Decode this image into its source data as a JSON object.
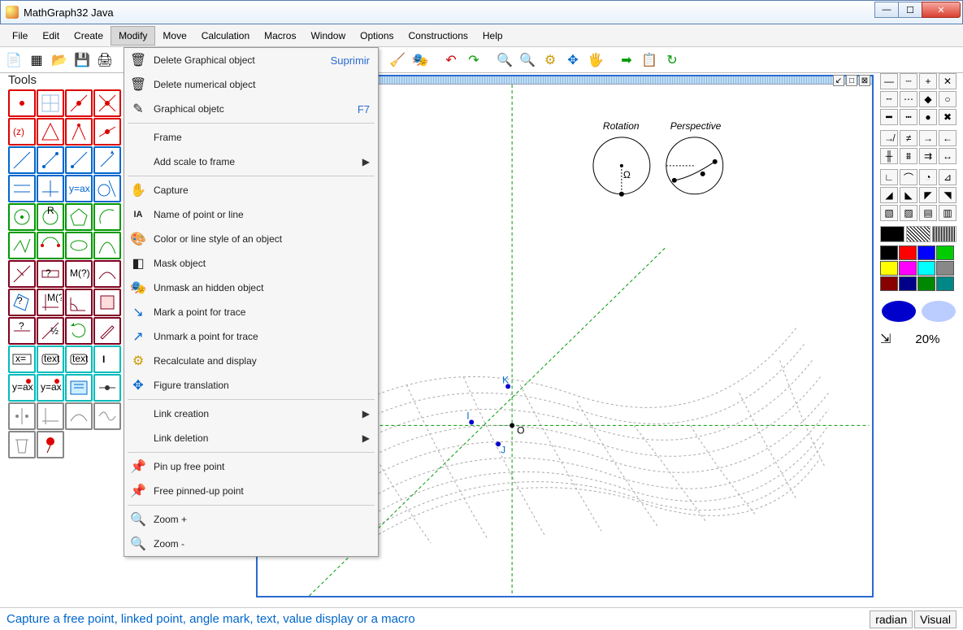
{
  "window": {
    "title": "MathGraph32 Java"
  },
  "menubar": [
    "File",
    "Edit",
    "Create",
    "Modify",
    "Move",
    "Calculation",
    "Macros",
    "Window",
    "Options",
    "Constructions",
    "Help"
  ],
  "active_menu_index": 3,
  "dropdown": [
    {
      "label": "Delete Graphical object",
      "shortcut": "Suprimir",
      "icon": "🗑"
    },
    {
      "label": "Delete numerical object",
      "icon": "🗑"
    },
    {
      "label": "Graphical objetc",
      "shortcut": "F7",
      "icon": "✎"
    },
    {
      "sep": true
    },
    {
      "label": "Frame"
    },
    {
      "label": "Add scale to frame",
      "submenu": true
    },
    {
      "sep": true
    },
    {
      "label": "Capture",
      "icon": "✋"
    },
    {
      "label": "Name of point or line",
      "icon": "IA"
    },
    {
      "label": "Color or line style of an object",
      "icon": "▦"
    },
    {
      "label": "Mask object",
      "icon": "◧"
    },
    {
      "label": "Unmask an hidden object",
      "icon": "🎭"
    },
    {
      "label": "Mark a point for trace",
      "icon": "↘"
    },
    {
      "label": "Unmark a point for trace",
      "icon": "↗"
    },
    {
      "label": "Recalculate and display",
      "icon": "⚙"
    },
    {
      "label": "Figure translation",
      "icon": "✥"
    },
    {
      "sep": true
    },
    {
      "label": "Link creation",
      "submenu": true
    },
    {
      "label": "Link deletion",
      "submenu": true
    },
    {
      "sep": true
    },
    {
      "label": "Pin up free point",
      "icon": "📌"
    },
    {
      "label": "Free pinned-up point",
      "icon": "📌"
    },
    {
      "sep": true
    },
    {
      "label": "Zoom +",
      "icon": "🔍"
    },
    {
      "label": "Zoom -",
      "icon": "🔍"
    }
  ],
  "tools_label": "Tools",
  "statusbar": {
    "hint": "Capture a free point, linked point, angle mark, text, value display or a macro",
    "right": [
      "radian",
      "Visual"
    ]
  },
  "canvas": {
    "labels": [
      "Rotation",
      "Perspective",
      "K",
      "I",
      "J",
      "O",
      "Ω"
    ]
  },
  "right_panel": {
    "zoom_label": "20%",
    "palette": [
      "#000000",
      "#ff0000",
      "#0000ff",
      "#00ff00",
      "#ffff00",
      "#ff00ff",
      "#00ffff",
      "#808080",
      "#800000",
      "#000080",
      "#008000",
      "#008080"
    ]
  }
}
